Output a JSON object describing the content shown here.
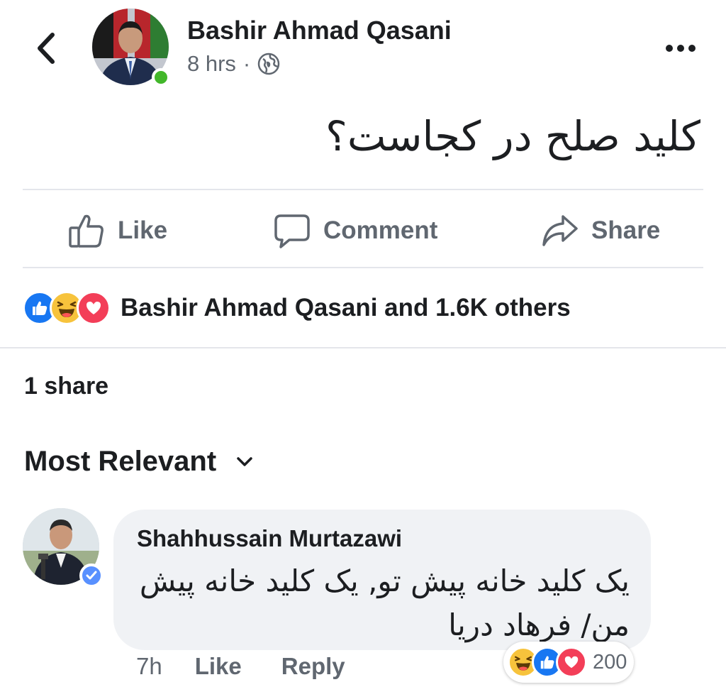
{
  "post": {
    "author": "Bashir Ahmad Qasani",
    "time": "8 hrs",
    "separator": "·",
    "audience_icon": "globe-icon",
    "text": "کلید صلح در کجاست؟"
  },
  "actions": {
    "like": "Like",
    "comment": "Comment",
    "share": "Share"
  },
  "reactions": {
    "icons": [
      "like",
      "haha",
      "love"
    ],
    "text": "Bashir Ahmad Qasani and 1.6K others"
  },
  "shares": "1 share",
  "sort": {
    "label": "Most Relevant"
  },
  "comment": {
    "author": "Shahhussain Murtazawi",
    "text": "یک کلید خانه پیش تو, یک کلید خانه پیش من/ فرهاد دریا",
    "time": "7h",
    "like": "Like",
    "reply": "Reply",
    "reaction_icons": [
      "haha",
      "like",
      "love"
    ],
    "reaction_count": "200"
  },
  "colors": {
    "like_blue": "#1877f2",
    "love_red": "#f33e58",
    "haha_yellow": "#f7c33c",
    "online_green": "#42b72a",
    "verified_blue": "#5890ff",
    "secondary_text": "#606770"
  }
}
